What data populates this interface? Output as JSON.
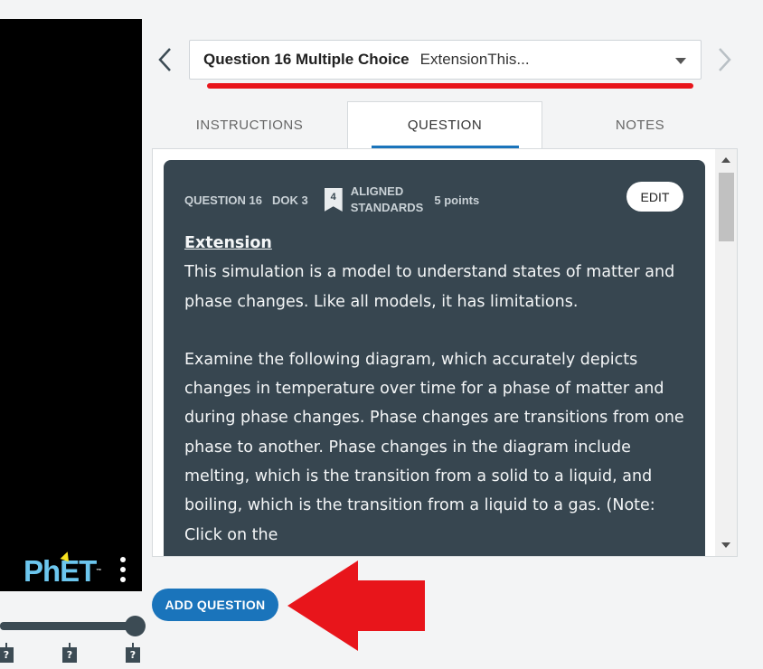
{
  "sim": {
    "logo_text": "PhET",
    "logo_tm": "™"
  },
  "timeline": {
    "markers": [
      "?",
      "?",
      "?"
    ]
  },
  "question_selector": {
    "title": "Question 16 Multiple Choice",
    "subtitle": "ExtensionThis..."
  },
  "tabs": [
    {
      "label": "INSTRUCTIONS"
    },
    {
      "label": "QUESTION"
    },
    {
      "label": "NOTES"
    }
  ],
  "card": {
    "question_label": "QUESTION 16",
    "dok_label": "DOK 3",
    "standards_count": "4",
    "aligned_line1": "ALIGNED",
    "aligned_line2": "STANDARDS",
    "points": "5 points",
    "edit_label": "EDIT",
    "heading": "Extension",
    "paragraph1": "This simulation is a model to understand states of matter and phase changes. Like all models, it has limitations.",
    "paragraph2": "Examine the following diagram, which accurately depicts changes in temperature over time for a phase of matter and during phase changes. Phase changes are transitions from one phase to another. Phase changes in the diagram include melting, which is the transition from a solid to a liquid, and boiling, which is the transition from a liquid to a gas. (Note: Click on the"
  },
  "add_question_label": "ADD QUESTION",
  "colors": {
    "accent": "#1a74bb",
    "card_bg": "#374650",
    "annotation_red": "#e8151b"
  }
}
